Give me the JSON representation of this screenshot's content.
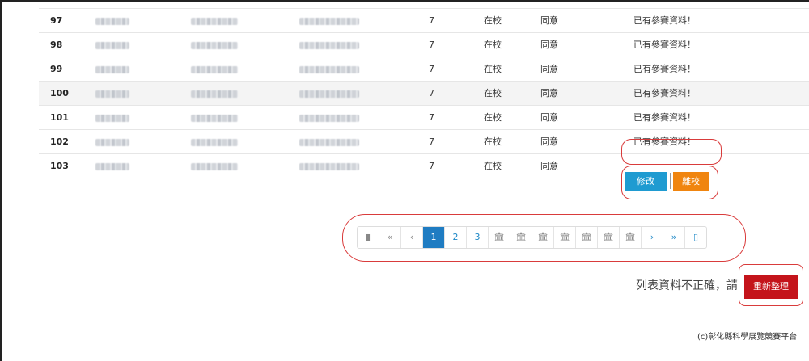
{
  "table": {
    "rows": [
      {
        "num": "97",
        "grade": "7",
        "status": "在校",
        "agree": "同意",
        "message": "已有參賽資料！"
      },
      {
        "num": "98",
        "grade": "7",
        "status": "在校",
        "agree": "同意",
        "message": "已有參賽資料！"
      },
      {
        "num": "99",
        "grade": "7",
        "status": "在校",
        "agree": "同意",
        "message": "已有參賽資料！"
      },
      {
        "num": "100",
        "grade": "7",
        "status": "在校",
        "agree": "同意",
        "message": "已有參賽資料！"
      },
      {
        "num": "101",
        "grade": "7",
        "status": "在校",
        "agree": "同意",
        "message": "已有參賽資料！"
      },
      {
        "num": "102",
        "grade": "7",
        "status": "在校",
        "agree": "同意",
        "message": "已有參賽資料！"
      },
      {
        "num": "103",
        "grade": "7",
        "status": "在校",
        "agree": "同意",
        "message": ""
      }
    ],
    "actions": {
      "edit": "修改",
      "leave": "離校"
    }
  },
  "pagination": {
    "items": [
      {
        "label": "▮",
        "icon": "first-bar-icon"
      },
      {
        "label": "«",
        "icon": "double-left-icon"
      },
      {
        "label": "‹",
        "icon": "left-icon"
      },
      {
        "label": "1"
      },
      {
        "label": "2"
      },
      {
        "label": "3"
      },
      {
        "label": "🏛",
        "icon": "building-icon"
      },
      {
        "label": "🏛",
        "icon": "building-icon"
      },
      {
        "label": "🏛",
        "icon": "building-icon"
      },
      {
        "label": "🏛",
        "icon": "building-icon"
      },
      {
        "label": "🏛",
        "icon": "building-icon"
      },
      {
        "label": "🏛",
        "icon": "building-icon"
      },
      {
        "label": "🏛",
        "icon": "building-icon"
      },
      {
        "label": "›",
        "icon": "right-icon"
      },
      {
        "label": "»",
        "icon": "double-right-icon"
      },
      {
        "label": "▯",
        "icon": "last-box-icon"
      }
    ],
    "active": "1"
  },
  "refresh": {
    "note": "列表資料不正確，請",
    "button": "重新整理"
  },
  "footer": {
    "text": "(c)彰化縣科學展覽競賽平台"
  },
  "colors": {
    "edit": "#1f9bd1",
    "leave": "#f0850f",
    "refresh": "#c4141b",
    "active_page": "#1f7cc2",
    "annotation": "#d93b3b"
  }
}
